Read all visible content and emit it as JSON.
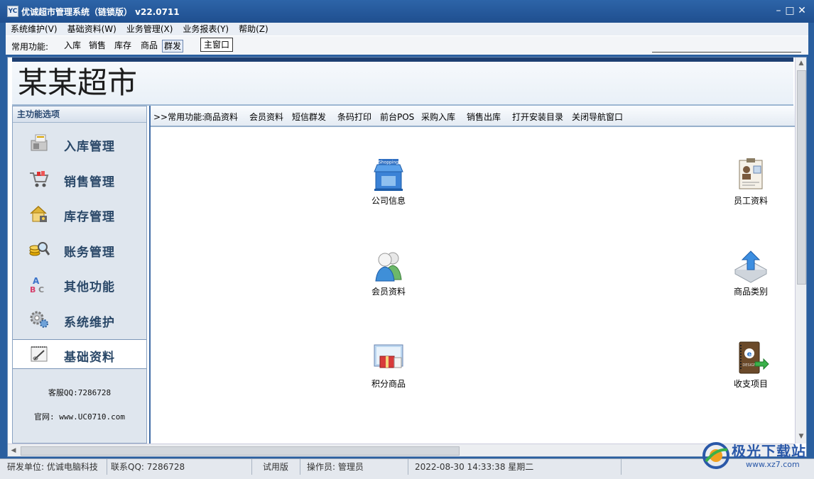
{
  "window": {
    "title": "优诚超市管理系统（链锁版）  v22.0711",
    "app_icon_text": "YC",
    "minimize": "–",
    "maximize": "□",
    "close": "✕"
  },
  "menubar": [
    "系统维护(V)",
    "基础资料(W)",
    "业务管理(X)",
    "业务报表(Y)",
    "帮助(Z)"
  ],
  "toolbar": {
    "label": "常用功能:",
    "items": [
      "入库",
      "销售",
      "库存",
      "商品",
      "群发"
    ],
    "selected": "群发",
    "main_window": "主窗口"
  },
  "header": {
    "brand": "某某超市"
  },
  "sidebar": {
    "title": "主功能选项",
    "items": [
      {
        "label": "入库管理",
        "icon": "warehouse-in-icon"
      },
      {
        "label": "销售管理",
        "icon": "shopping-cart-icon"
      },
      {
        "label": "库存管理",
        "icon": "house-lock-icon"
      },
      {
        "label": "账务管理",
        "icon": "coins-magnifier-icon"
      },
      {
        "label": "其他功能",
        "icon": "letters-icon"
      },
      {
        "label": "系统维护",
        "icon": "gears-icon"
      },
      {
        "label": "基础资料",
        "icon": "notepad-pen-icon"
      }
    ],
    "active": "基础资料",
    "service_qq": "客服QQ:7286728",
    "website": "官网: www.UC0710.com"
  },
  "quickbar": {
    "label": ">>常用功能:",
    "items": [
      "商品资料",
      "会员资料",
      "短信群发",
      "条码打印",
      "前台POS",
      "采购入库",
      "销售出库",
      "打开安装目录",
      "关闭导航窗口"
    ]
  },
  "tiles": [
    {
      "label": "公司信息",
      "icon": "store-icon"
    },
    {
      "label": "员工资料",
      "icon": "clipboard-person-icon"
    },
    {
      "label": "会员资料",
      "icon": "users-icon"
    },
    {
      "label": "商品类别",
      "icon": "upload-arrow-icon"
    },
    {
      "label": "积分商品",
      "icon": "gift-board-icon"
    },
    {
      "label": "收支项目",
      "icon": "ledger-book-icon"
    }
  ],
  "tile_store_sign": "Shopping",
  "tile_book_text": "DESIGN",
  "status": {
    "developer": "研发单位: 优诚电脑科技",
    "contact": "联系QQ: 7286728",
    "edition": "试用版",
    "operator": "操作员: 管理员",
    "datetime": "2022-08-30 14:33:38 星期二"
  },
  "watermark": {
    "text": "极光下载站",
    "url": "www.xz7.com"
  }
}
